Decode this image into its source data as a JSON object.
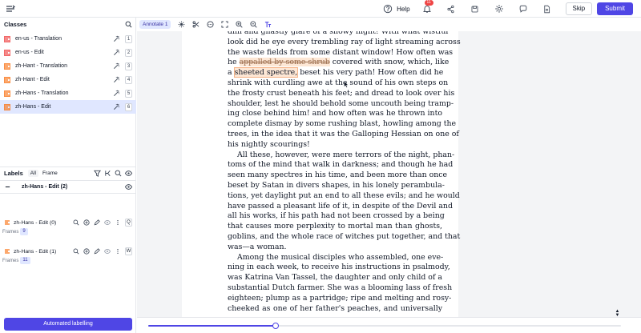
{
  "topbar": {
    "help_label": "Help",
    "notifications_count": "11",
    "skip_label": "Skip",
    "submit_label": "Submit"
  },
  "classes": {
    "title": "Classes",
    "items": [
      {
        "name": "en-us - Translation",
        "key": "1",
        "tool": "magic-wand-icon",
        "color": "#ef4444"
      },
      {
        "name": "en-us - Edit",
        "key": "2",
        "tool": "magic-wand-icon",
        "color": "#ef4444"
      },
      {
        "name": "zh-Hant - Translation",
        "key": "3",
        "tool": "magic-wand-icon",
        "color": "#f97316"
      },
      {
        "name": "zh-Hant - Edit",
        "key": "4",
        "tool": "magic-wand-icon",
        "color": "#f97316"
      },
      {
        "name": "zh-Hans - Translation",
        "key": "5",
        "tool": "magic-wand-icon",
        "color": "#f97316"
      },
      {
        "name": "zh-Hans - Edit",
        "key": "6",
        "tool": "magic-wand-icon",
        "color": "#f97316",
        "active": true
      }
    ]
  },
  "labels": {
    "title": "Labels",
    "filter_all": "All",
    "filter_frame": "Frame",
    "group_title": "zh-Hans - Edit (2)",
    "objects": [
      {
        "name": "zh-Hans - Edit (0)",
        "frames_label": "Frames",
        "frames_count": "9",
        "key": "Q"
      },
      {
        "name": "zh-Hans - Edit (1)",
        "frames_label": "Frames",
        "frames_count": "11",
        "key": "W"
      }
    ],
    "auto_label": "Automated labelling"
  },
  "toolbar": {
    "annotate_label": "Annotate 1"
  },
  "document": {
    "lines": [
      {
        "parts": [
          {
            "t": "dim and ghastly glare of a snowy night! With what wistful"
          }
        ]
      },
      {
        "parts": [
          {
            "t": "look did he eye every trembling ray of light streaming across"
          }
        ]
      },
      {
        "parts": [
          {
            "t": "the waste fields from some distant window! How often was"
          }
        ]
      },
      {
        "parts": [
          {
            "t": "he "
          },
          {
            "t": "appalled by some shrub",
            "hl": "strike"
          },
          {
            "t": " covered with snow, which, like"
          }
        ]
      },
      {
        "parts": [
          {
            "t": "a "
          },
          {
            "t": "sheeted spectre,",
            "hl": "box"
          },
          {
            "t": " beset his very path! How often did he"
          }
        ]
      },
      {
        "parts": [
          {
            "t": "shrink with curdling awe at the sound of his own steps on"
          }
        ]
      },
      {
        "parts": [
          {
            "t": "the frosty crust beneath his feet; and dread to look over his"
          }
        ]
      },
      {
        "parts": [
          {
            "t": "shoulder, lest he should behold some uncouth being tramp-"
          }
        ]
      },
      {
        "parts": [
          {
            "t": "ing close behind him! and how often was he thrown into"
          }
        ]
      },
      {
        "parts": [
          {
            "t": "complete dismay by some rushing blast, howling among the"
          }
        ]
      },
      {
        "parts": [
          {
            "t": "trees, in the idea that it was the Galloping Hessian on one of"
          }
        ]
      },
      {
        "parts": [
          {
            "t": "his nightly scourings!"
          }
        ],
        "last": true
      },
      {
        "parts": [
          {
            "t": "All these, however, were mere terrors of the night, phan-"
          }
        ],
        "indent": true
      },
      {
        "parts": [
          {
            "t": "toms of the mind that walk in darkness; and though he had"
          }
        ]
      },
      {
        "parts": [
          {
            "t": "seen many spectres in his time, and been more than once"
          }
        ]
      },
      {
        "parts": [
          {
            "t": "beset by Satan in divers shapes, in his lonely perambula-"
          }
        ]
      },
      {
        "parts": [
          {
            "t": "tions, yet daylight put an end to all these evils; and he would"
          }
        ]
      },
      {
        "parts": [
          {
            "t": "have passed a pleasant life of it, in despite of the Devil and"
          }
        ]
      },
      {
        "parts": [
          {
            "t": "all his works, if his path had not been crossed by a being"
          }
        ]
      },
      {
        "parts": [
          {
            "t": "that causes more perplexity to mortal man than ghosts,"
          }
        ]
      },
      {
        "parts": [
          {
            "t": "goblins, and the whole race of witches put together, and that"
          }
        ]
      },
      {
        "parts": [
          {
            "t": "was—a woman."
          }
        ],
        "last": true
      },
      {
        "parts": [
          {
            "t": "Among the musical disciples who assembled, one eve-"
          }
        ],
        "indent": true
      },
      {
        "parts": [
          {
            "t": "ning in each week, to receive his instructions in psalmody,"
          }
        ]
      },
      {
        "parts": [
          {
            "t": "was Katrina Van Tassel, the daughter and only child of a"
          }
        ]
      },
      {
        "parts": [
          {
            "t": "substantial Dutch farmer. She was a blooming lass of fresh"
          }
        ]
      },
      {
        "parts": [
          {
            "t": "eighteen; plump as a partridge; ripe and melting and rosy-"
          }
        ]
      },
      {
        "parts": [
          {
            "t": "cheeked as one of her father's peaches, and universally"
          }
        ]
      }
    ]
  },
  "timeline": {
    "progress_fraction": 0.27
  },
  "colors": {
    "accent": "#4f46e5",
    "highlight": "#fde7d5"
  }
}
